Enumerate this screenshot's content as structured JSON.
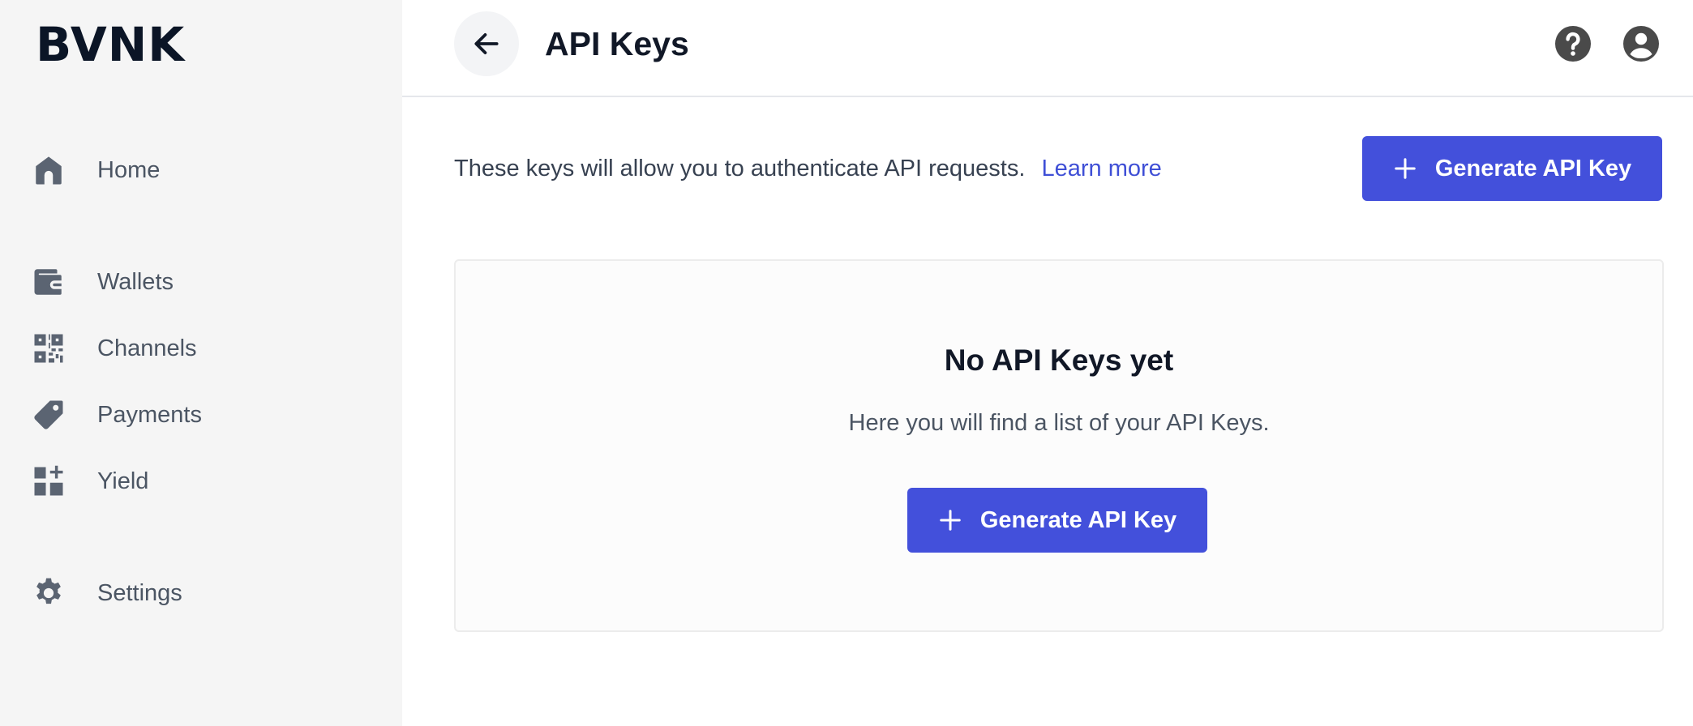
{
  "brand": {
    "logo_text": "BVNK"
  },
  "sidebar": {
    "items": [
      {
        "label": "Home",
        "icon": "home-icon"
      },
      {
        "label": "Wallets",
        "icon": "wallet-icon"
      },
      {
        "label": "Channels",
        "icon": "qr-grid-icon"
      },
      {
        "label": "Payments",
        "icon": "tag-icon"
      },
      {
        "label": "Yield",
        "icon": "grid-plus-icon"
      },
      {
        "label": "Settings",
        "icon": "gear-icon"
      }
    ]
  },
  "header": {
    "title": "API Keys",
    "back_icon": "arrow-left-icon",
    "help_icon": "help-circle-icon",
    "account_icon": "user-circle-icon"
  },
  "main": {
    "intro_text": "These keys will allow you to authenticate API requests.",
    "learn_more_label": "Learn more",
    "generate_button_label": "Generate API Key",
    "empty_state": {
      "title": "No API Keys yet",
      "subtitle": "Here you will find a list of your API Keys.",
      "button_label": "Generate API Key"
    }
  },
  "colors": {
    "accent": "#4350db",
    "link": "#3f4fd6",
    "sidebar_bg": "#f5f5f5",
    "icon_gray": "#5b6472"
  }
}
